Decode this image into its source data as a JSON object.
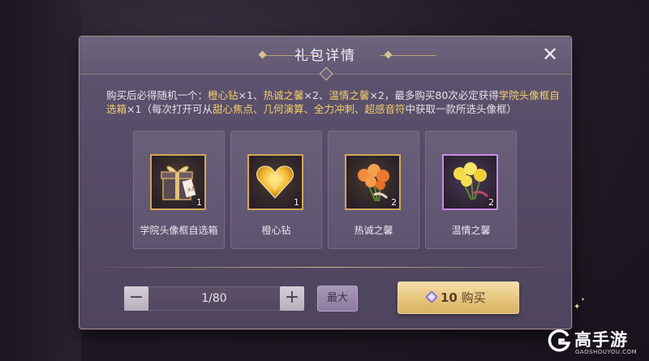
{
  "dialog": {
    "title": "礼包详情",
    "close_icon": "close-icon"
  },
  "description": {
    "part1": "购买后必得随机一个：",
    "hl1": "橙心钻",
    "part2": "×1、",
    "hl2": "热诚之馨",
    "part3": "×2、",
    "hl3": "温情之馨",
    "part4": "×2，最多购买80次必定获得",
    "hl4": "学院头像框自选箱",
    "part5": "×1（每次打开可从",
    "hl5": "甜心焦点、几何演算、全力冲刺、超感音符",
    "part6": "中获取一款所选头像框）"
  },
  "items": [
    {
      "label": "学院头像框自选箱",
      "quantity": "1",
      "icon": "gift-box-icon",
      "frame_color": "#d3a65a"
    },
    {
      "label": "橙心钻",
      "quantity": "1",
      "icon": "heart-diamond-icon",
      "frame_color": "#d3a65a"
    },
    {
      "label": "热诚之馨",
      "quantity": "2",
      "icon": "orange-roses-icon",
      "frame_color": "#d3a65a"
    },
    {
      "label": "温情之馨",
      "quantity": "2",
      "icon": "yellow-roses-icon",
      "frame_color": "#c58de8"
    }
  ],
  "purchase": {
    "count_display": "1/80",
    "max_label": "最大",
    "price": "10",
    "buy_label": "购买",
    "minus": "−",
    "plus": "+"
  },
  "watermark": {
    "name": "高手游",
    "url": "GAOSHOUYOU.COM"
  },
  "colors": {
    "dialog_bg": "#5f5570",
    "highlight": "#f5cf6a",
    "gold_frame": "#d3a65a",
    "purple_frame": "#c58de8",
    "buy_button": "#e6c57d"
  }
}
